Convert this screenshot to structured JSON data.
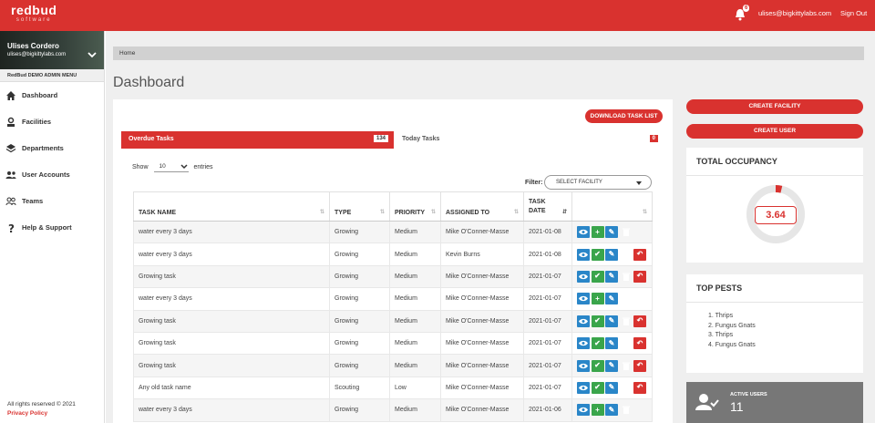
{
  "brand": {
    "name": "redbud",
    "tagline": "software"
  },
  "topbar": {
    "notification_count": "6",
    "user_email": "ulises@bigkittylabs.com",
    "signout_label": "Sign Out"
  },
  "sidebar": {
    "user_name": "Ulises Cordero",
    "user_email": "ulises@bigkittylabs.com",
    "menu_title": "RedBud DEMO ADMIN MENU",
    "items": [
      {
        "label": "Dashboard",
        "icon": "home-icon"
      },
      {
        "label": "Facilities",
        "icon": "facility-icon"
      },
      {
        "label": "Departments",
        "icon": "layers-icon"
      },
      {
        "label": "User Accounts",
        "icon": "users-icon"
      },
      {
        "label": "Teams",
        "icon": "team-icon"
      },
      {
        "label": "Help & Support",
        "icon": "help-icon"
      }
    ],
    "footer_text": "All rights reserved © 2021",
    "privacy_label": "Privacy Policy"
  },
  "breadcrumb": "Home",
  "page_title": "Dashboard",
  "tasks": {
    "download_label": "DOWNLOAD TASK LIST",
    "tabs": [
      {
        "label": "Overdue Tasks",
        "count": "134"
      },
      {
        "label": "Today Tasks",
        "count": "0"
      }
    ],
    "show_label": "Show",
    "show_value": "10",
    "entries_label": "entries",
    "filter_label": "Filter:",
    "filter_placeholder": "SELECT FACILITY",
    "columns": [
      "TASK NAME",
      "TYPE",
      "PRIORITY",
      "ASSIGNED TO",
      "TASK DATE",
      ""
    ],
    "rows": [
      {
        "name": "water every 3 days",
        "type": "Growing",
        "priority": "Medium",
        "assigned": "Mike O'Conner-Masse",
        "date": "2021-01-08",
        "actions": [
          "view",
          "add",
          "edit",
          "delete"
        ]
      },
      {
        "name": "water every 3 days",
        "type": "Growing",
        "priority": "Medium",
        "assigned": "Kevin Burns",
        "date": "2021-01-08",
        "actions": [
          "view",
          "done",
          "edit",
          "delete",
          "undo"
        ]
      },
      {
        "name": "Growing task",
        "type": "Growing",
        "priority": "Medium",
        "assigned": "Mike O'Conner-Masse",
        "date": "2021-01-07",
        "actions": [
          "view",
          "done",
          "edit",
          "delete",
          "undo"
        ]
      },
      {
        "name": "water every 3 days",
        "type": "Growing",
        "priority": "Medium",
        "assigned": "Mike O'Conner-Masse",
        "date": "2021-01-07",
        "actions": [
          "view",
          "add",
          "edit",
          "delete"
        ]
      },
      {
        "name": "Growing task",
        "type": "Growing",
        "priority": "Medium",
        "assigned": "Mike O'Conner-Masse",
        "date": "2021-01-07",
        "actions": [
          "view",
          "done",
          "edit",
          "delete",
          "undo"
        ]
      },
      {
        "name": "Growing task",
        "type": "Growing",
        "priority": "Medium",
        "assigned": "Mike O'Conner-Masse",
        "date": "2021-01-07",
        "actions": [
          "view",
          "done",
          "edit",
          "delete",
          "undo"
        ]
      },
      {
        "name": "Growing task",
        "type": "Growing",
        "priority": "Medium",
        "assigned": "Mike O'Conner-Masse",
        "date": "2021-01-07",
        "actions": [
          "view",
          "done",
          "edit",
          "delete",
          "undo"
        ]
      },
      {
        "name": "Any old task name",
        "type": "Scouting",
        "priority": "Low",
        "assigned": "Mike O'Conner-Masse",
        "date": "2021-01-07",
        "actions": [
          "view",
          "done",
          "edit",
          "delete",
          "undo"
        ]
      },
      {
        "name": "water every 3 days",
        "type": "Growing",
        "priority": "Medium",
        "assigned": "Mike O'Conner-Masse",
        "date": "2021-01-06",
        "actions": [
          "view",
          "add",
          "edit",
          "delete"
        ]
      }
    ]
  },
  "right": {
    "create_facility_label": "CREATE FACILITY",
    "create_user_label": "CREATE USER",
    "occupancy_title": "TOTAL OCCUPANCY",
    "occupancy_value": "3.64",
    "occupancy_fraction": 0.0364,
    "pests_title": "TOP PESTS",
    "pests": [
      "1. Thrips",
      "2. Fungus Gnats",
      "3. Thrips",
      "4. Fungus Gnats"
    ],
    "active_users_label": "ACTIVE USERS",
    "active_users_value": "11"
  },
  "colors": {
    "brand_red": "#d9322f",
    "view_blue": "#2a86c8",
    "action_green": "#3aa54b"
  }
}
